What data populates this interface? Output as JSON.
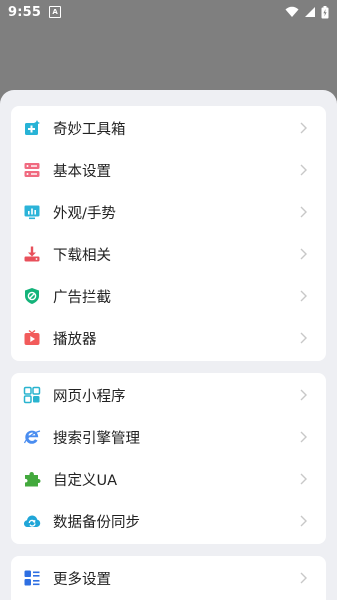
{
  "status": {
    "time": "9:55",
    "notif": "A"
  },
  "menu": {
    "group1": [
      {
        "label": "奇妙工具箱",
        "icon": "toolbox-icon"
      },
      {
        "label": "基本设置",
        "icon": "settings-server-icon"
      },
      {
        "label": "外观/手势",
        "icon": "appearance-icon"
      },
      {
        "label": "下载相关",
        "icon": "download-icon"
      },
      {
        "label": "广告拦截",
        "icon": "adblock-shield-icon"
      },
      {
        "label": "播放器",
        "icon": "player-icon"
      }
    ],
    "group2": [
      {
        "label": "网页小程序",
        "icon": "mini-apps-icon"
      },
      {
        "label": "搜索引擎管理",
        "icon": "search-engine-icon"
      },
      {
        "label": "自定义UA",
        "icon": "puzzle-ua-icon"
      },
      {
        "label": "数据备份同步",
        "icon": "sync-cloud-icon"
      }
    ],
    "group3": [
      {
        "label": "更多设置",
        "icon": "more-settings-icon"
      }
    ]
  },
  "colors": {
    "toolbox": "#27b3d6",
    "settings": "#f06a80",
    "appearance": "#2bb3d8",
    "download": "#e8505b",
    "adblock": "#14b37a",
    "player": "#f25b5b",
    "miniapps": "#29b4cf",
    "search": "#4a8df0",
    "ua": "#43a93d",
    "sync": "#20a6d8",
    "more": "#2e6fe2"
  }
}
